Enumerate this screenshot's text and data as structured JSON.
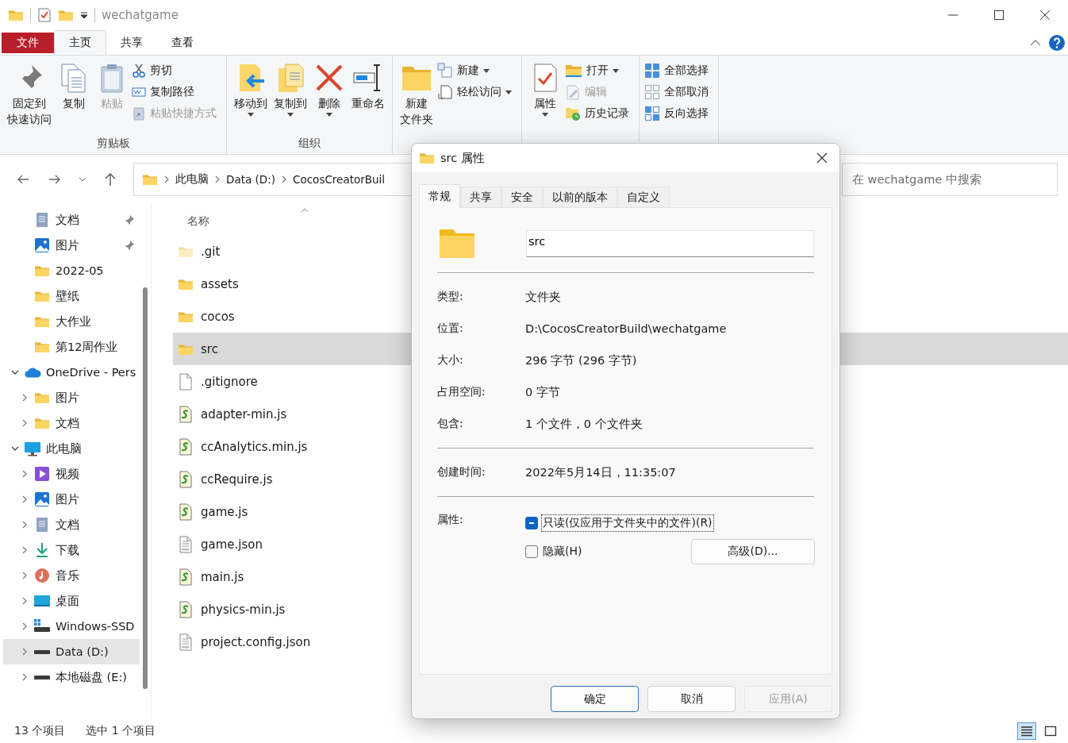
{
  "window": {
    "title": "wechatgame"
  },
  "ribbon_tabs": [
    {
      "label": "文件",
      "kind": "file-menu",
      "selected": false
    },
    {
      "label": "主页",
      "kind": "tab",
      "selected": true
    },
    {
      "label": "共享",
      "kind": "tab",
      "selected": false
    },
    {
      "label": "查看",
      "kind": "tab",
      "selected": false
    }
  ],
  "ribbon_groups": [
    {
      "label": "剪贴板",
      "buttons": [
        {
          "lines": [
            "固定到",
            "快速访问"
          ],
          "kind": "large",
          "dropdown": false,
          "disabled": false
        },
        {
          "lines": [
            "复制"
          ],
          "kind": "large",
          "dropdown": false,
          "disabled": false
        },
        {
          "lines": [
            "粘贴"
          ],
          "kind": "large",
          "dropdown": false,
          "disabled": true
        },
        {
          "label": "剪切",
          "kind": "small",
          "dropdown": false,
          "disabled": false
        },
        {
          "label": "复制路径",
          "kind": "small",
          "dropdown": false,
          "disabled": false
        },
        {
          "label": "粘贴快捷方式",
          "kind": "small",
          "dropdown": false,
          "disabled": true
        }
      ]
    },
    {
      "label": "组织",
      "buttons": [
        {
          "lines": [
            "移动到"
          ],
          "kind": "large",
          "dropdown": true,
          "disabled": false
        },
        {
          "lines": [
            "复制到"
          ],
          "kind": "large",
          "dropdown": true,
          "disabled": false
        },
        {
          "lines": [
            "删除"
          ],
          "kind": "large",
          "dropdown": true,
          "disabled": false
        },
        {
          "lines": [
            "重命名"
          ],
          "kind": "large",
          "dropdown": false,
          "disabled": false
        }
      ]
    },
    {
      "buttons": [
        {
          "lines": [
            "新建",
            "文件夹"
          ],
          "kind": "large",
          "dropdown": false,
          "disabled": false
        },
        {
          "label": "新建",
          "kind": "small",
          "dropdown": true,
          "disabled": false
        },
        {
          "label": "轻松访问",
          "kind": "small",
          "dropdown": true,
          "disabled": false
        }
      ]
    },
    {
      "buttons": [
        {
          "lines": [
            "属性"
          ],
          "kind": "large",
          "dropdown": true,
          "disabled": false
        },
        {
          "label": "打开",
          "kind": "small",
          "dropdown": true,
          "disabled": false
        },
        {
          "label": "编辑",
          "kind": "small",
          "dropdown": false,
          "disabled": true
        },
        {
          "label": "历史记录",
          "kind": "small",
          "dropdown": false,
          "disabled": false
        }
      ]
    },
    {
      "buttons": [
        {
          "label": "全部选择",
          "kind": "small",
          "dropdown": false,
          "disabled": false
        },
        {
          "label": "全部取消",
          "kind": "small",
          "dropdown": false,
          "disabled": false
        },
        {
          "label": "反向选择",
          "kind": "small",
          "dropdown": false,
          "disabled": false
        }
      ]
    }
  ],
  "breadcrumb": [
    "此电脑",
    "Data (D:)",
    "CocosCreatorBuil"
  ],
  "search": {
    "placeholder": "在 wechatgame 中搜索"
  },
  "quick_access": [
    {
      "label": "文档",
      "kind": "documents",
      "pinned": true,
      "selected": false
    },
    {
      "label": "图片",
      "kind": "pictures",
      "pinned": true,
      "selected": false
    },
    {
      "label": "2022-05",
      "kind": "folder",
      "pinned": false,
      "selected": false
    },
    {
      "label": "壁纸",
      "kind": "folder",
      "pinned": false,
      "selected": false
    },
    {
      "label": "大作业",
      "kind": "folder",
      "pinned": false,
      "selected": false
    },
    {
      "label": "第12周作业",
      "kind": "folder",
      "pinned": false,
      "selected": false
    }
  ],
  "tree": [
    {
      "label": "OneDrive - Pers",
      "kind": "cloud",
      "expanded": true,
      "selected": false,
      "children": [
        {
          "label": "图片",
          "kind": "folder",
          "expanded": false,
          "selected": false
        },
        {
          "label": "文档",
          "kind": "folder",
          "expanded": false,
          "selected": false
        }
      ]
    },
    {
      "label": "此电脑",
      "kind": "pc",
      "expanded": true,
      "selected": false,
      "children": [
        {
          "label": "视频",
          "kind": "video",
          "expanded": false,
          "selected": false
        },
        {
          "label": "图片",
          "kind": "pictures",
          "expanded": false,
          "selected": false
        },
        {
          "label": "文档",
          "kind": "documents",
          "expanded": false,
          "selected": false
        },
        {
          "label": "下载",
          "kind": "download",
          "expanded": false,
          "selected": false
        },
        {
          "label": "音乐",
          "kind": "music",
          "expanded": false,
          "selected": false
        },
        {
          "label": "桌面",
          "kind": "desktop",
          "expanded": false,
          "selected": false
        },
        {
          "label": "Windows-SSD",
          "kind": "system-drive",
          "expanded": false,
          "selected": false
        },
        {
          "label": "Data (D:)",
          "kind": "drive",
          "expanded": false,
          "selected": true
        },
        {
          "label": "本地磁盘 (E:)",
          "kind": "drive",
          "expanded": false,
          "selected": false
        }
      ]
    }
  ],
  "file_list": {
    "column": "名称",
    "files": [
      {
        "name": ".git",
        "kind": "hidden-folder",
        "selected": false
      },
      {
        "name": "assets",
        "kind": "folder",
        "selected": false
      },
      {
        "name": "cocos",
        "kind": "folder",
        "selected": false
      },
      {
        "name": "src",
        "kind": "folder",
        "selected": true
      },
      {
        "name": ".gitignore",
        "kind": "file",
        "selected": false
      },
      {
        "name": "adapter-min.js",
        "kind": "script",
        "selected": false
      },
      {
        "name": "ccAnalytics.min.js",
        "kind": "script",
        "selected": false
      },
      {
        "name": "ccRequire.js",
        "kind": "script",
        "selected": false
      },
      {
        "name": "game.js",
        "kind": "script",
        "selected": false
      },
      {
        "name": "game.json",
        "kind": "json",
        "selected": false
      },
      {
        "name": "main.js",
        "kind": "script",
        "selected": false
      },
      {
        "name": "physics-min.js",
        "kind": "script",
        "selected": false
      },
      {
        "name": "project.config.json",
        "kind": "json",
        "selected": false
      }
    ]
  },
  "status_bar": {
    "count": "13 个项目",
    "selection": "选中 1 个项目",
    "views": [
      {
        "kind": "details",
        "selected": true
      },
      {
        "kind": "tiles",
        "selected": false
      }
    ]
  },
  "dialog": {
    "title": "src 属性",
    "tabs": [
      {
        "label": "常规",
        "selected": true
      },
      {
        "label": "共享",
        "selected": false
      },
      {
        "label": "安全",
        "selected": false
      },
      {
        "label": "以前的版本",
        "selected": false
      },
      {
        "label": "自定义",
        "selected": false
      }
    ],
    "name_value": "src",
    "sections": [
      {
        "rows": [
          {
            "label": "类型:",
            "value": "文件夹"
          },
          {
            "label": "位置:",
            "value": "D:\\CocosCreatorBuild\\wechatgame"
          },
          {
            "label": "大小:",
            "value": "296 字节 (296 字节)"
          },
          {
            "label": "占用空间:",
            "value": "0 字节"
          },
          {
            "label": "包含:",
            "value": "1 个文件，0 个文件夹"
          }
        ]
      },
      {
        "rows": [
          {
            "label": "创建时间:",
            "value": "2022年5月14日，11:35:07"
          }
        ]
      }
    ],
    "attributes_label": "属性:",
    "attributes": [
      {
        "label": "只读(仅应用于文件夹中的文件)(R)",
        "indeterminate": true,
        "focused": true
      },
      {
        "label": "隐藏(H)",
        "checked": false,
        "indeterminate": false,
        "focused": false
      }
    ],
    "advanced_button": "高级(D)...",
    "buttons": [
      {
        "label": "确定",
        "kind": "default",
        "disabled": false
      },
      {
        "label": "取消",
        "kind": "normal",
        "disabled": false
      },
      {
        "label": "应用(A)",
        "kind": "normal",
        "disabled": true
      }
    ]
  }
}
